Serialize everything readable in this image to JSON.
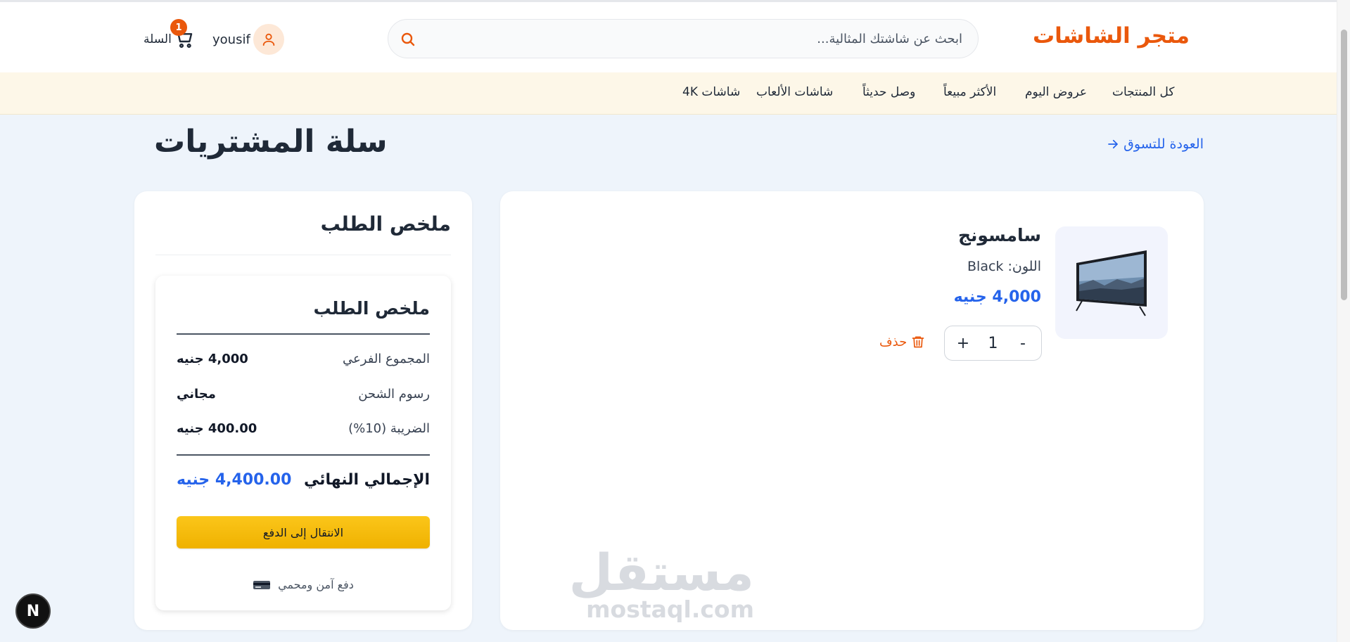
{
  "header": {
    "logo": "متجر الشاشات",
    "search_placeholder": "ابحث عن شاشتك المثالية...",
    "user_name": "yousif",
    "cart_label": "السلة",
    "cart_count": "1"
  },
  "nav": {
    "items": [
      "كل المنتجات",
      "عروض اليوم",
      "الأكثر مبيعاً",
      "وصل حديثاً",
      "شاشات الألعاب",
      "شاشات 4K"
    ]
  },
  "page": {
    "back_link": "العودة للتسوق",
    "title": "سلة المشتريات"
  },
  "cart": {
    "item": {
      "name": "سامسونج",
      "color_label": "اللون: Black",
      "price": "4,000 جنيه",
      "quantity": "1",
      "minus": "-",
      "plus": "+",
      "delete_label": "حذف"
    }
  },
  "summary": {
    "outer_title": "ملخص الطلب",
    "title": "ملخص الطلب",
    "subtotal_label": "المجموع الفرعي",
    "subtotal_value": "4,000 جنيه",
    "shipping_label": "رسوم الشحن",
    "shipping_value": "مجاني",
    "tax_label": "الضريبة (10%)",
    "tax_value": "400.00 جنيه",
    "total_label": "الإجمالي النهائي",
    "total_value": "4,400.00 جنيه",
    "checkout_label": "الانتقال إلى الدفع",
    "secure_note": "دفع آمن ومحمي"
  },
  "watermark": {
    "arabic": "مستقل",
    "latin": "mostaql.com"
  },
  "floating_badge": "N",
  "colors": {
    "brand_orange": "#ea580c",
    "price_blue": "#2563eb",
    "checkout_yellow": "#fbc61a",
    "nav_bg": "#fdf7e8",
    "page_bg": "#eef4fb"
  }
}
